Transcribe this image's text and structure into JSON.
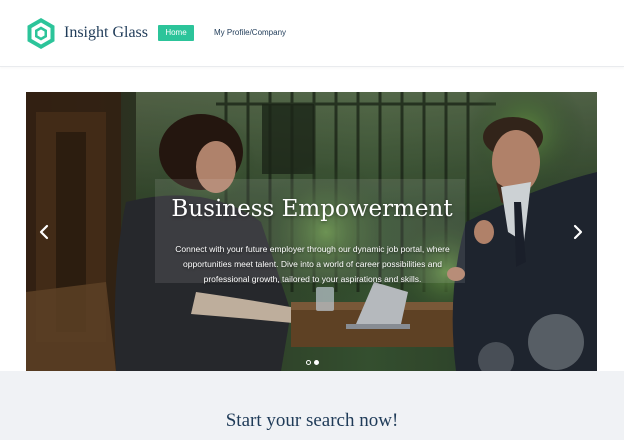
{
  "header": {
    "brand": "Insight Glass",
    "nav": {
      "home": "Home",
      "profile": "My Profile/Company"
    }
  },
  "hero": {
    "title": "Business Empowerment",
    "text": "Connect with your future employer through our dynamic job portal, where opportunities meet talent. Dive into a world of career possibilities and professional growth, tailored to your aspirations and skills.",
    "prev_icon": "chevron-left-icon",
    "next_icon": "chevron-right-icon",
    "slide_count": 2,
    "active_slide": 2
  },
  "search": {
    "title": "Start your search now!"
  },
  "colors": {
    "accent": "#2cc49a",
    "navy": "#1f3b58",
    "section_bg": "#f0f2f5"
  }
}
